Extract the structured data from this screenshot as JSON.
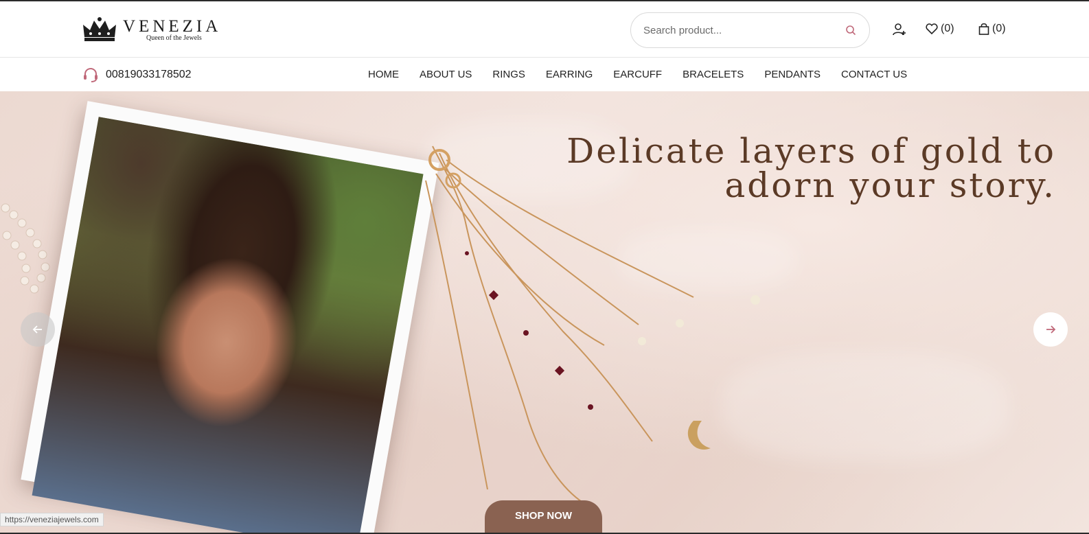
{
  "brand": {
    "name": "VENEZIA",
    "tagline": "Queen of the Jewels"
  },
  "search": {
    "placeholder": "Search product..."
  },
  "header_icons": {
    "wishlist_count": "(0)",
    "cart_count": "(0)"
  },
  "contact": {
    "phone": "00819033178502"
  },
  "nav": {
    "items": [
      {
        "label": "HOME"
      },
      {
        "label": "ABOUT US"
      },
      {
        "label": "RINGS"
      },
      {
        "label": "EARRING"
      },
      {
        "label": "EARCUFF"
      },
      {
        "label": "BRACELETS"
      },
      {
        "label": "PENDANTS"
      },
      {
        "label": "CONTACT US"
      }
    ]
  },
  "hero": {
    "headline_line1": "Delicate layers of gold to",
    "headline_line2": "adorn your story.",
    "cta_label": "SHOP NOW"
  },
  "status_bar": {
    "url": "https://veneziajewels.com"
  },
  "colors": {
    "accent": "#c0697a",
    "cta_bg": "#8a6251",
    "headline": "#5b3a26"
  }
}
